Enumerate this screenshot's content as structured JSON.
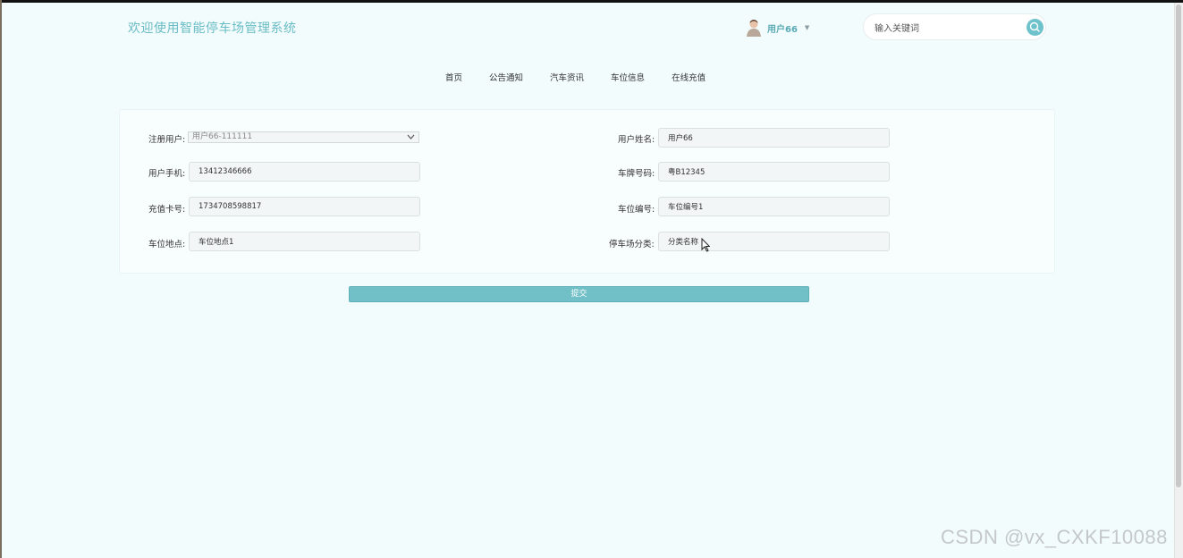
{
  "header": {
    "site_title": "欢迎使用智能停车场管理系统",
    "user_name": "用户66",
    "search_placeholder": "输入关键词"
  },
  "nav": {
    "items": [
      "首页",
      "公告通知",
      "汽车资讯",
      "车位信息",
      "在线充值"
    ]
  },
  "form": {
    "reg_user": {
      "label": "注册用户:",
      "value": "用户66-111111"
    },
    "user_name": {
      "label": "用户姓名:",
      "value": "用户66"
    },
    "user_phone": {
      "label": "用户手机:",
      "value": "13412346666"
    },
    "plate_number": {
      "label": "车牌号码:",
      "value": "粤B12345"
    },
    "card_number": {
      "label": "充值卡号:",
      "value": "1734708598817"
    },
    "space_number": {
      "label": "车位编号:",
      "value": "车位编号1"
    },
    "space_location": {
      "label": "车位地点:",
      "value": "车位地点1"
    },
    "lot_category": {
      "label": "停车场分类:",
      "value": "分类名称"
    },
    "submit_label": "提交"
  },
  "watermark": "CSDN @vx_CXKF10088",
  "colors": {
    "accent": "#6ec2cb",
    "background": "#f2fcfd",
    "title": "#6bbcc5"
  }
}
